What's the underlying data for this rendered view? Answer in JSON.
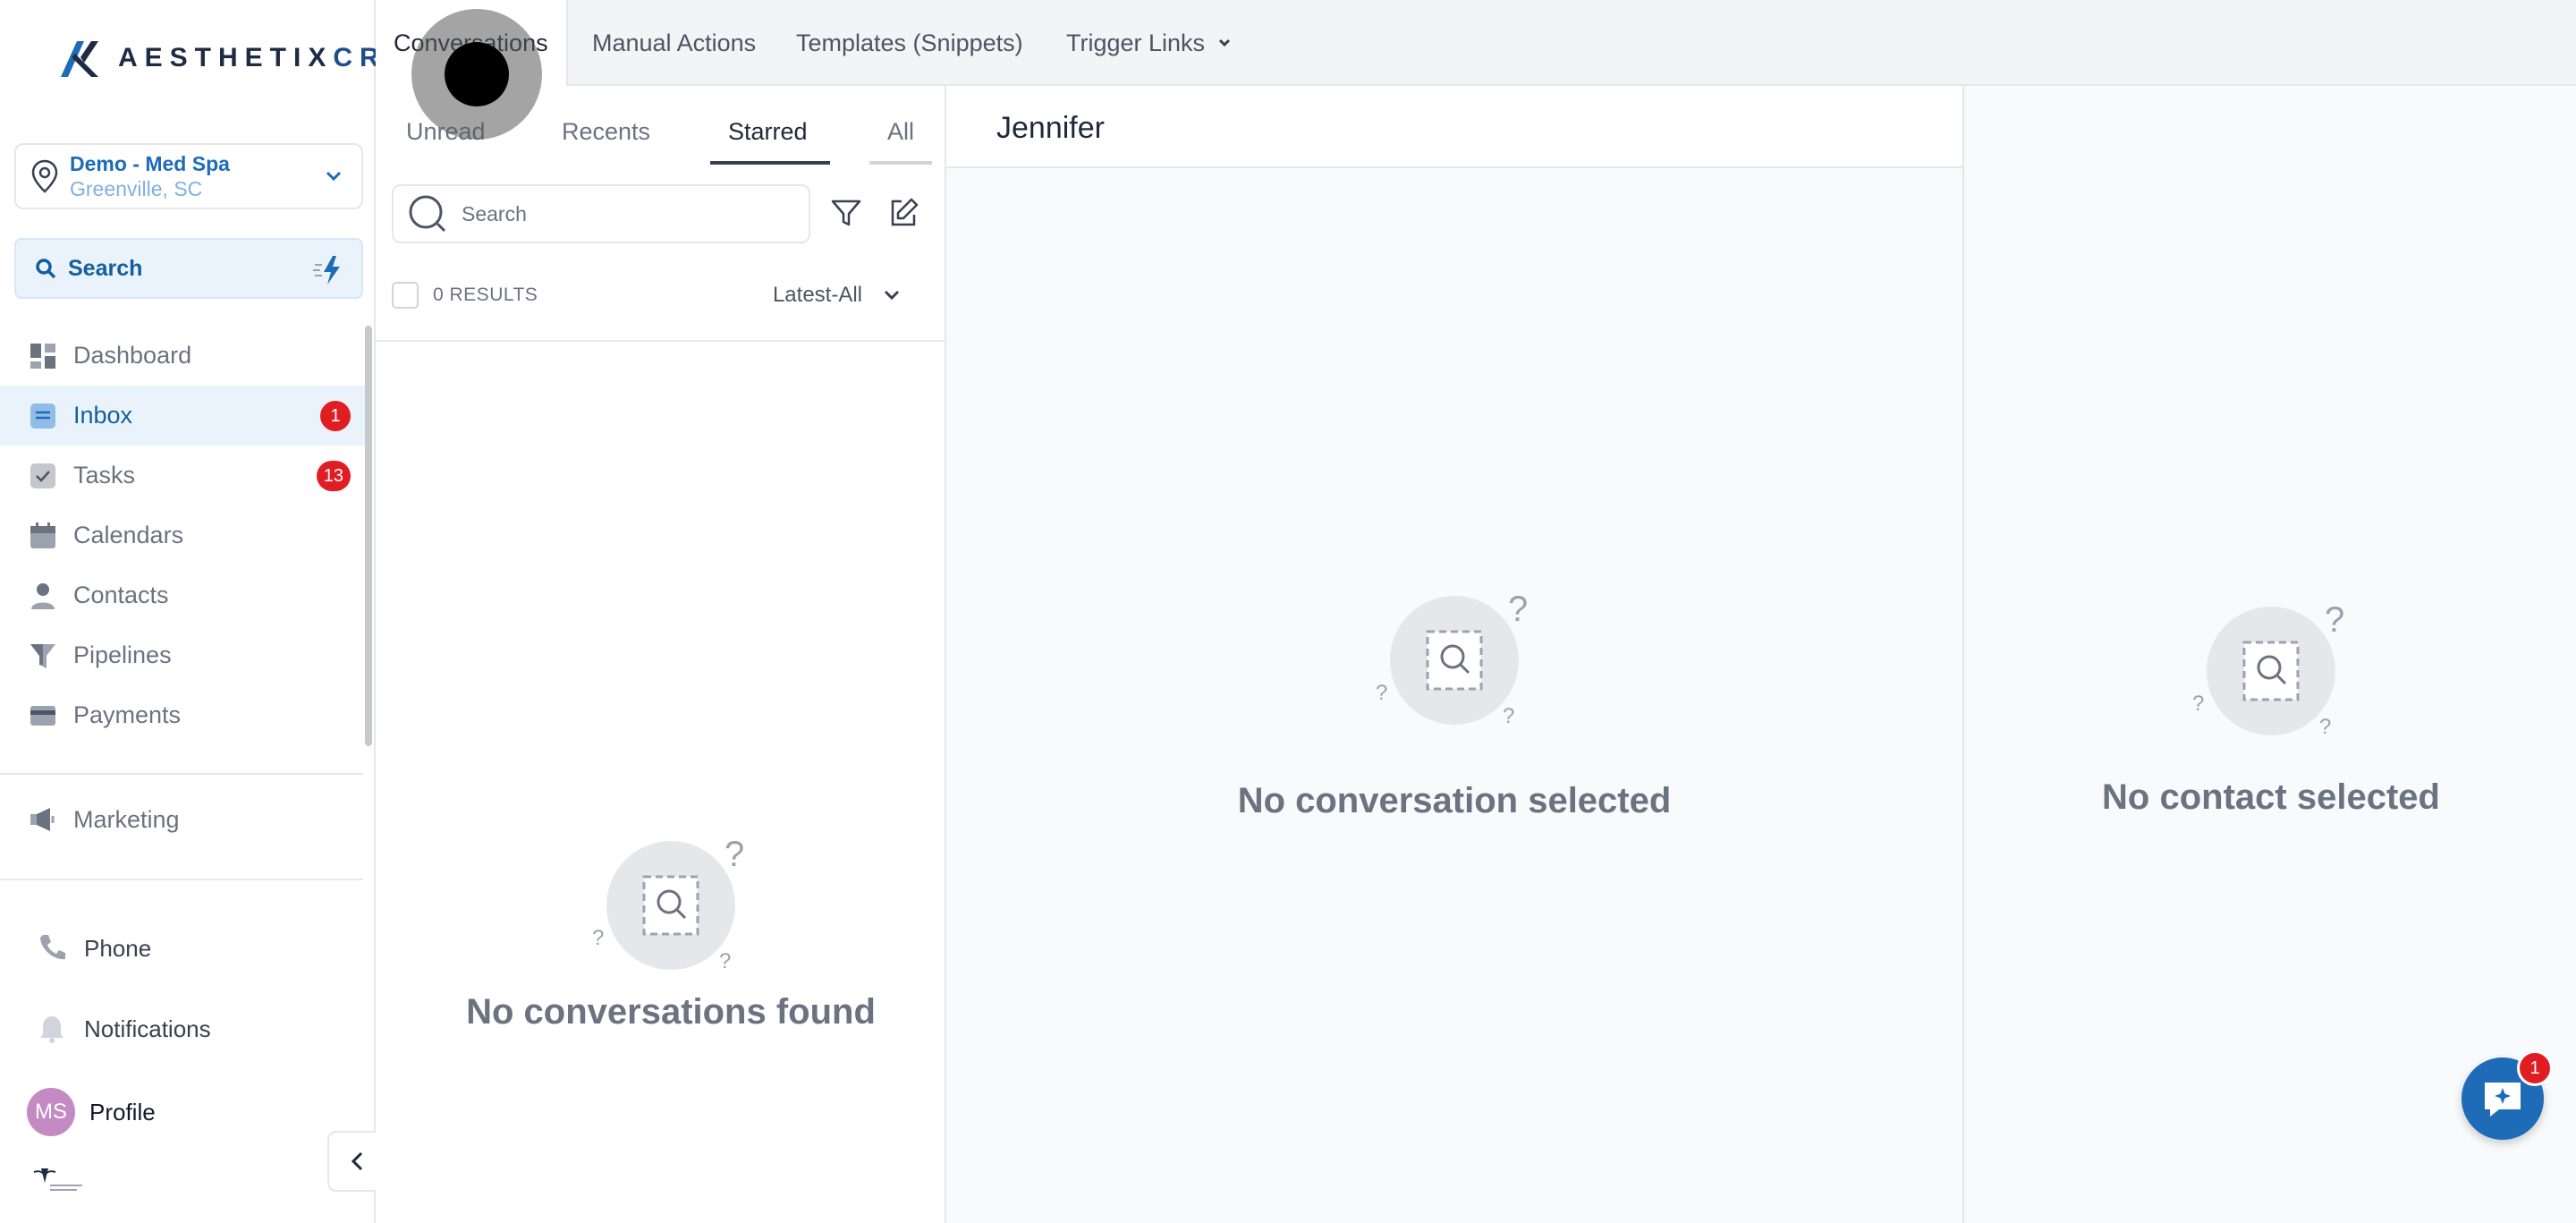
{
  "brand": {
    "name_main": "AESTHETIX",
    "name_accent": "CRM"
  },
  "location": {
    "name": "Demo - Med Spa",
    "city": "Greenville, SC"
  },
  "sidebar": {
    "search_label": "Search",
    "items": [
      {
        "label": "Dashboard",
        "icon": "dashboard-icon"
      },
      {
        "label": "Inbox",
        "icon": "inbox-icon",
        "badge": "1",
        "active": true
      },
      {
        "label": "Tasks",
        "icon": "tasks-icon",
        "badge": "13"
      },
      {
        "label": "Calendars",
        "icon": "calendar-icon"
      },
      {
        "label": "Contacts",
        "icon": "contacts-icon"
      },
      {
        "label": "Pipelines",
        "icon": "pipelines-icon"
      },
      {
        "label": "Payments",
        "icon": "payments-icon"
      }
    ],
    "marketing": "Marketing",
    "phone": "Phone",
    "notifications": "Notifications",
    "profile": {
      "initials": "MS",
      "label": "Profile"
    }
  },
  "top_tabs": {
    "conversations": "Conversations",
    "manual_actions": "Manual Actions",
    "templates": "Templates (Snippets)",
    "trigger_links": "Trigger Links"
  },
  "sub_tabs": {
    "unread": "Unread",
    "recents": "Recents",
    "starred": "Starred",
    "all": "All"
  },
  "list": {
    "search_placeholder": "Search",
    "results": "0 RESULTS",
    "sort": "Latest-All",
    "empty": "No conversations found"
  },
  "conversation": {
    "contact_name": "Jennifer",
    "empty": "No conversation selected"
  },
  "contact_panel": {
    "empty": "No contact selected"
  },
  "chat_widget": {
    "badge": "1"
  },
  "colors": {
    "accent": "#1e6bb8",
    "badge": "#e11d24",
    "active_bg": "#eaf3fc"
  }
}
